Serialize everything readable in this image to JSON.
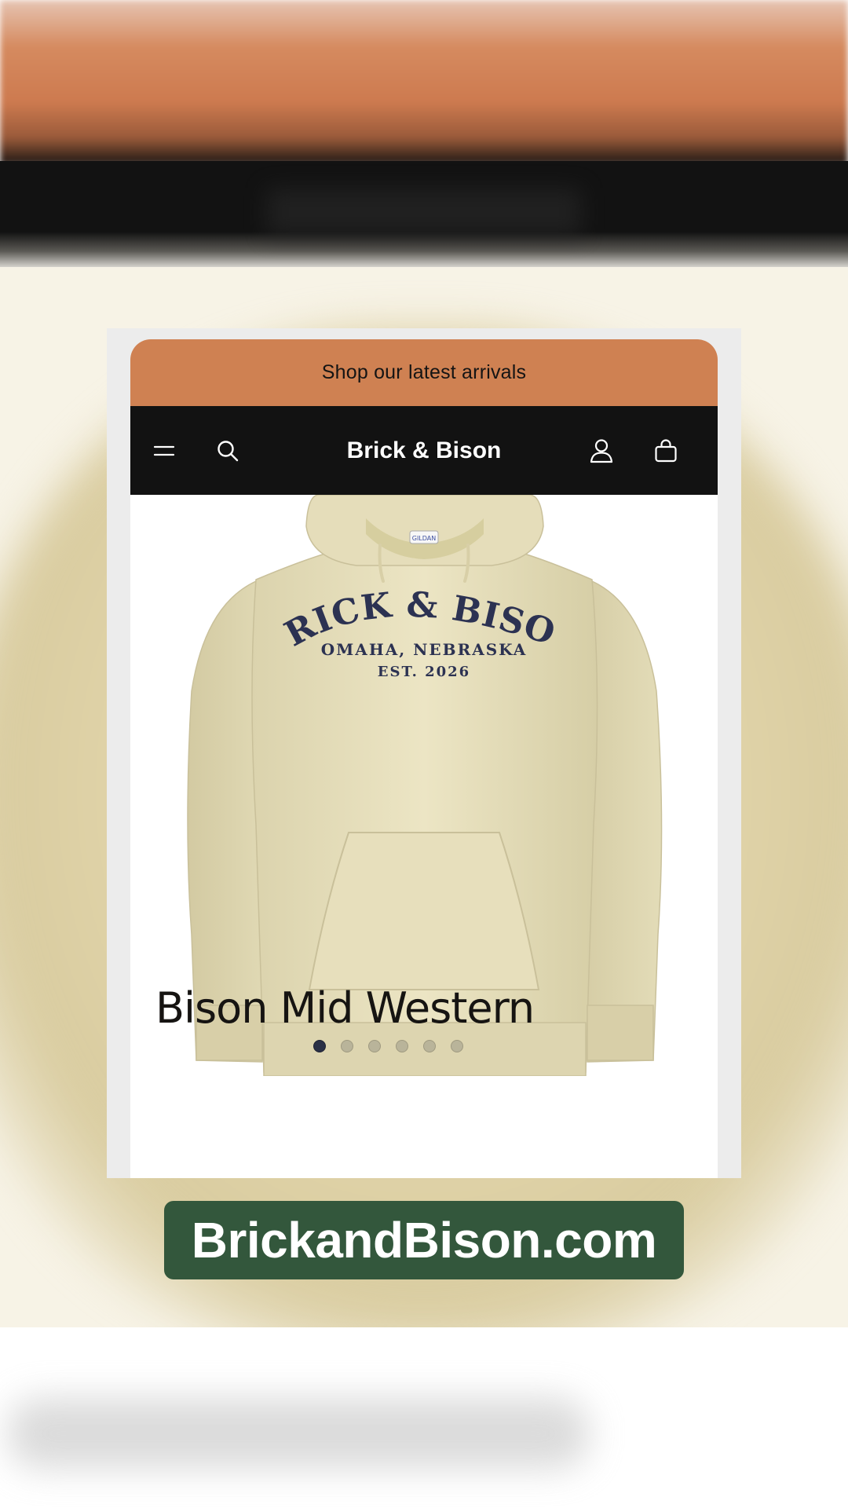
{
  "announcement": {
    "text": "Shop our latest arrivals"
  },
  "header": {
    "brand": "Brick & Bison",
    "icons": [
      "menu-icon",
      "search-icon",
      "account-icon",
      "cart-icon"
    ]
  },
  "product": {
    "title": "Bison Mid Western",
    "print": {
      "line1": "BRICK & BISON",
      "line2": "OMAHA, NEBRASKA",
      "line3": "EST. 2026"
    },
    "gallery": {
      "image_count": 6,
      "active_index": 0
    }
  },
  "website": {
    "label": "BrickandBison.com"
  },
  "colors": {
    "announcement_bg": "#cf8152",
    "header_bg": "#121212",
    "hoodie": "#ebe4c2",
    "print_ink": "#2c3252",
    "badge_bg": "#33573c"
  }
}
